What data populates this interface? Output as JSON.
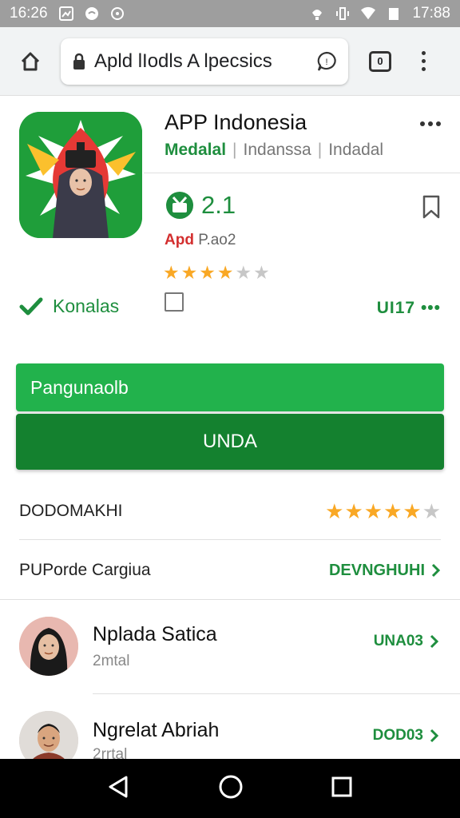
{
  "status_bar": {
    "time_left": "16:26",
    "time_right": "17:88"
  },
  "browser": {
    "url": "Apld lIodls A lpecsics",
    "tabs_count": "0"
  },
  "app": {
    "title": "APP Indonesia",
    "tags": [
      "Medalal",
      "Indanssa",
      "Indadal"
    ],
    "rating_value": "2.1",
    "ad_prefix": "Apd",
    "ad_text": "P.ao2",
    "stars_small": 4.5,
    "verified_label": "Konalas",
    "uid_text": "UI17"
  },
  "buttons": {
    "primary_label": "Pangunaolb",
    "install_label": "UNDA"
  },
  "rows": {
    "rating_label": "DODOMAKHI",
    "rating_stars": 5,
    "explore_label": "PUPorde Cargiua",
    "explore_action": "DEVNGHUHI"
  },
  "users": [
    {
      "name": "Nplada Satica",
      "sub": "2mtal",
      "action": "UNA03"
    },
    {
      "name": "Ngrelat Abriah",
      "sub": "2rrtal",
      "action": "DOD03"
    }
  ],
  "colors": {
    "brand_green": "#1e8e3e",
    "button_light": "#22b24c",
    "button_dark": "#14812f",
    "star": "#f9a825"
  }
}
